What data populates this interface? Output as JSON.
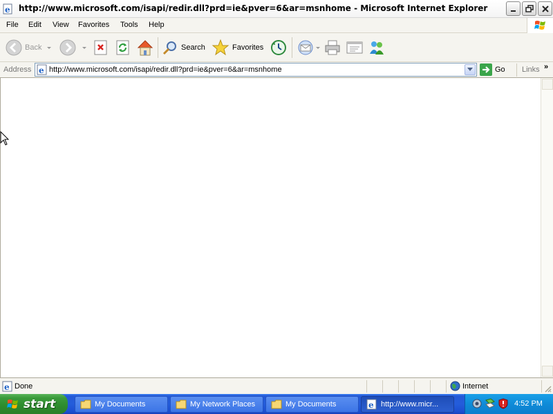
{
  "window": {
    "title": "http://www.microsoft.com/isapi/redir.dll?prd=ie&pver=6&ar=msnhome - Microsoft Internet Explorer"
  },
  "menu": {
    "items": [
      "File",
      "Edit",
      "View",
      "Favorites",
      "Tools",
      "Help"
    ]
  },
  "toolbar": {
    "back_label": "Back",
    "search_label": "Search",
    "favorites_label": "Favorites"
  },
  "address": {
    "label": "Address",
    "url": "http://www.microsoft.com/isapi/redir.dll?prd=ie&pver=6&ar=msnhome",
    "go_label": "Go",
    "links_label": "Links",
    "links_chevron": "»"
  },
  "status": {
    "text": "Done",
    "zone": "Internet"
  },
  "taskbar": {
    "start_label": "start",
    "tasks": [
      {
        "label": "My Documents",
        "icon": "folder-icon"
      },
      {
        "label": "My Network Places",
        "icon": "folder-icon"
      },
      {
        "label": "My Documents",
        "icon": "folder-icon"
      },
      {
        "label": "http://www.micr...",
        "icon": "ie-icon"
      }
    ],
    "clock": "4:52 PM"
  },
  "colors": {
    "taskbar": "#245ddb",
    "start_button": "#3a9a3a",
    "tray": "#0f8bd8"
  }
}
